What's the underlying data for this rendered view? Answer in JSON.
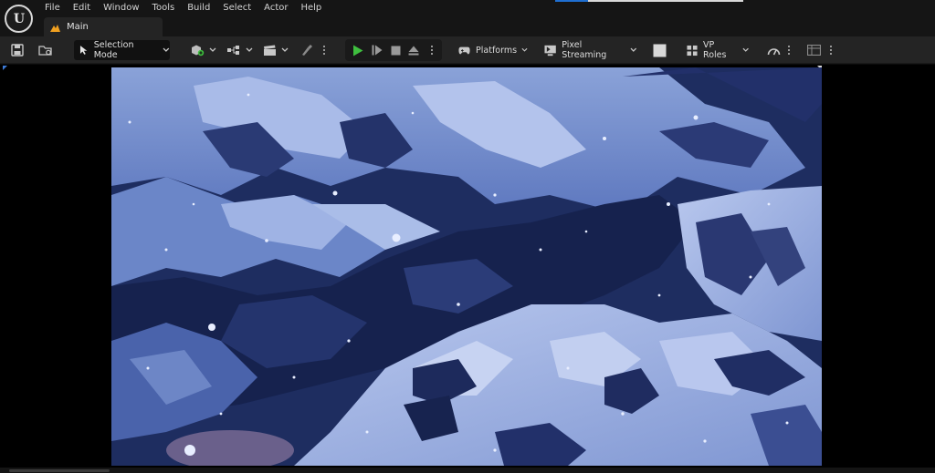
{
  "menu": [
    "File",
    "Edit",
    "Window",
    "Tools",
    "Build",
    "Select",
    "Actor",
    "Help"
  ],
  "tab": {
    "label": "Main"
  },
  "toolbar": {
    "selection_mode_label": "Selection Mode",
    "platforms_label": "Platforms",
    "pixel_streaming_label": "Pixel Streaming",
    "vp_roles_label": "VP Roles"
  },
  "icons": {
    "logo": "unreal-logo-icon",
    "save": "save-icon",
    "browse": "content-browser-icon",
    "add_actor": "add-actor-icon",
    "blueprints": "blueprint-icon",
    "cinematics": "clapperboard-icon",
    "modes": "paintbrush-icon",
    "play": "play-icon",
    "advance": "advance-frame-icon",
    "stop": "stop-icon",
    "eject": "eject-icon",
    "platforms": "gamepad-icon",
    "pixel_streaming": "monitor-icon",
    "vp_roles": "vp-roles-icon"
  },
  "colors": {
    "accent": "#1f6fd1",
    "play": "#3fbf3f",
    "tab_icon": "#f0a020"
  }
}
